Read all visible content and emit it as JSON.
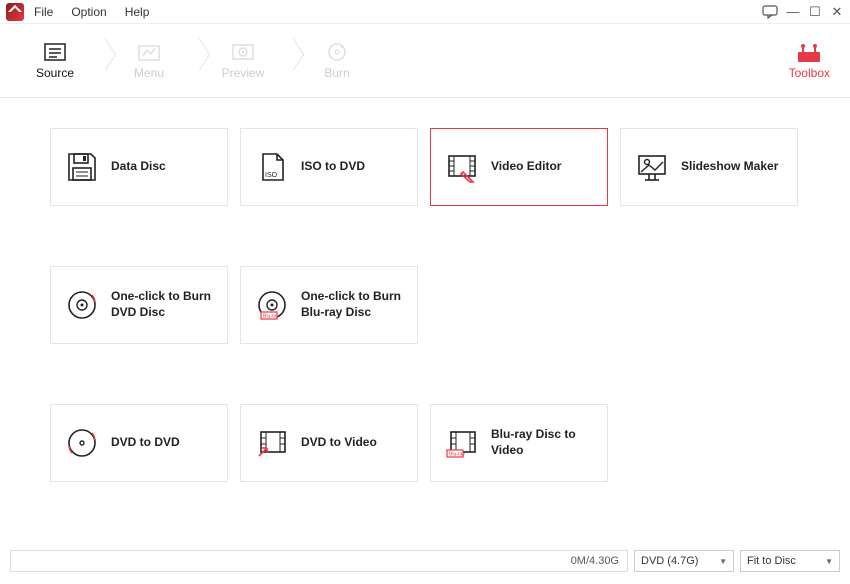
{
  "menu": {
    "file": "File",
    "option": "Option",
    "help": "Help"
  },
  "steps": {
    "source": "Source",
    "menu": "Menu",
    "preview": "Preview",
    "burn": "Burn"
  },
  "toolbox": "Toolbox",
  "cards": {
    "data_disc": "Data Disc",
    "iso_to_dvd": "ISO to DVD",
    "video_editor": "Video Editor",
    "slideshow": "Slideshow Maker",
    "oneclick_dvd": "One-click to Burn DVD Disc",
    "oneclick_bluray": "One-click to Burn Blu-ray Disc",
    "dvd_to_dvd": "DVD to DVD",
    "dvd_to_video": "DVD to Video",
    "bluray_to_video": "Blu-ray Disc to Video"
  },
  "bottom": {
    "progress": "0M/4.30G",
    "media": "DVD (4.7G)",
    "fit": "Fit to Disc"
  }
}
